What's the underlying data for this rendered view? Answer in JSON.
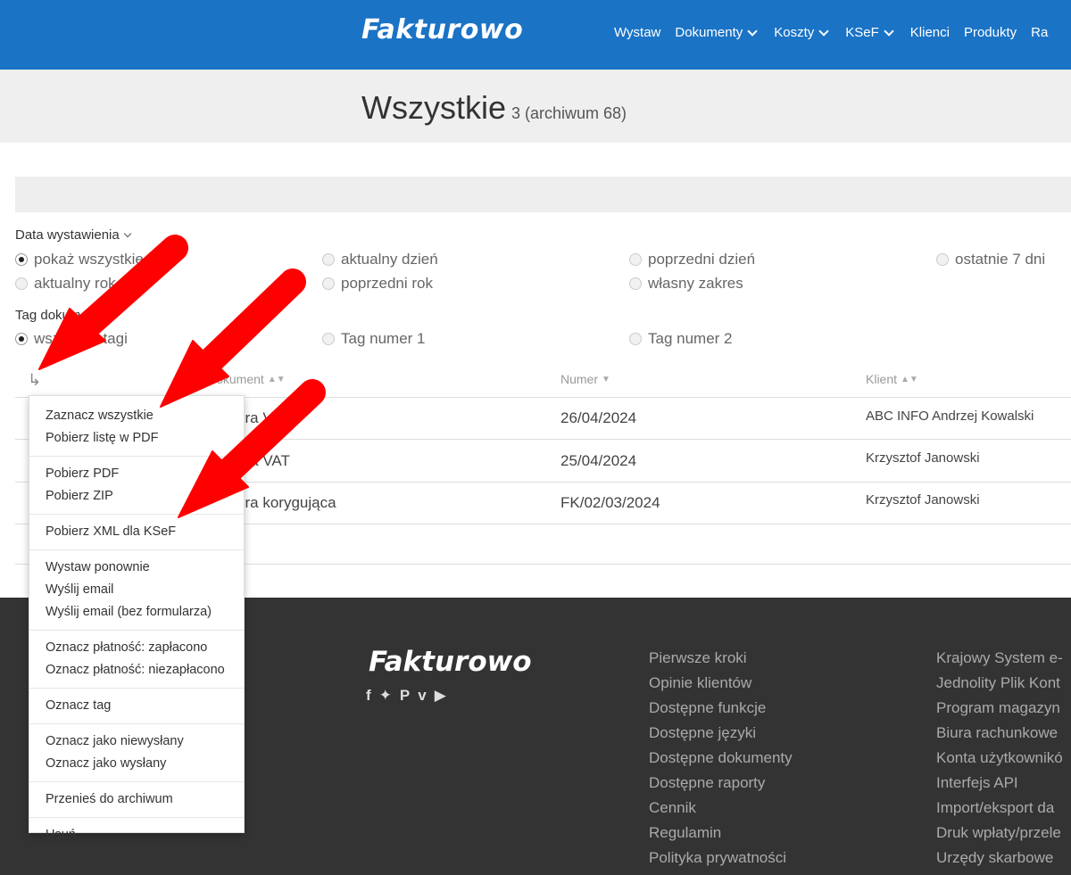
{
  "header": {
    "logo": "Fakturowo",
    "nav": [
      {
        "label": "Wystaw",
        "dropdown": false
      },
      {
        "label": "Dokumenty",
        "dropdown": true
      },
      {
        "label": "Koszty",
        "dropdown": true
      },
      {
        "label": "KSeF",
        "dropdown": true
      },
      {
        "label": "Klienci",
        "dropdown": false
      },
      {
        "label": "Produkty",
        "dropdown": false
      },
      {
        "label": "Ra",
        "dropdown": false
      }
    ]
  },
  "page": {
    "title": "Wszystkie",
    "count": "3 (archiwum 68)"
  },
  "filters": {
    "date": {
      "label": "Data wystawienia",
      "options": [
        {
          "label": "pokaż wszystkie",
          "selected": true
        },
        {
          "label": "aktualny dzień",
          "selected": false
        },
        {
          "label": "poprzedni dzień",
          "selected": false
        },
        {
          "label": "ostatnie 7 dni",
          "selected": false
        },
        {
          "label": "aktualny rok",
          "selected": false
        },
        {
          "label": "poprzedni rok",
          "selected": false
        },
        {
          "label": "własny zakres",
          "selected": false
        }
      ]
    },
    "tag": {
      "label": "Tag dokumentu",
      "options": [
        {
          "label": "wszystkie tagi",
          "selected": true
        },
        {
          "label": "Tag numer 1",
          "selected": false
        },
        {
          "label": "Tag numer 2",
          "selected": false
        }
      ]
    }
  },
  "table": {
    "columns": [
      "Dokument",
      "Numer",
      "Klient"
    ],
    "rows": [
      {
        "document": "Faktura VAT",
        "number": "26/04/2024",
        "client": "ABC INFO Andrzej Kowalski"
      },
      {
        "document": "Faktura VAT",
        "number": "25/04/2024",
        "client": "Krzysztof Janowski"
      },
      {
        "document": "Faktura korygująca",
        "number": "FK/02/03/2024",
        "client": "Krzysztof Janowski"
      }
    ]
  },
  "menu": {
    "groups": [
      [
        "Zaznacz wszystkie",
        "Pobierz listę w PDF"
      ],
      [
        "Pobierz PDF",
        "Pobierz ZIP"
      ],
      [
        "Pobierz XML dla KSeF"
      ],
      [
        "Wystaw ponownie",
        "Wyślij email",
        "Wyślij email (bez formularza)"
      ],
      [
        "Oznacz płatność: zapłacono",
        "Oznacz płatność: niezapłacono"
      ],
      [
        "Oznacz tag"
      ],
      [
        "Oznacz jako niewysłany",
        "Oznacz jako wysłany"
      ],
      [
        "Przenieś do archiwum"
      ],
      [
        "Usuń"
      ]
    ]
  },
  "footer": {
    "logo": "Fakturowo",
    "socials": [
      "facebook-icon",
      "twitter-icon",
      "pinterest-icon",
      "vimeo-icon",
      "youtube-icon"
    ],
    "col1": [
      "Pierwsze kroki",
      "Opinie klientów",
      "Dostępne funkcje",
      "Dostępne języki",
      "Dostępne dokumenty",
      "Dostępne raporty",
      "Cennik",
      "Regulamin",
      "Polityka prywatności"
    ],
    "col2": [
      "Krajowy System e-",
      "Jednolity Plik Kont",
      "Program magazyn",
      "Biura rachunkowe",
      "Konta użytkownikó",
      "Interfejs API",
      "Import/eksport da",
      "Druk wpłaty/przele",
      "Urzędy skarbowe"
    ]
  },
  "colors": {
    "header": "#1a73c5",
    "footer": "#333333",
    "arrow": "#ff0000"
  }
}
